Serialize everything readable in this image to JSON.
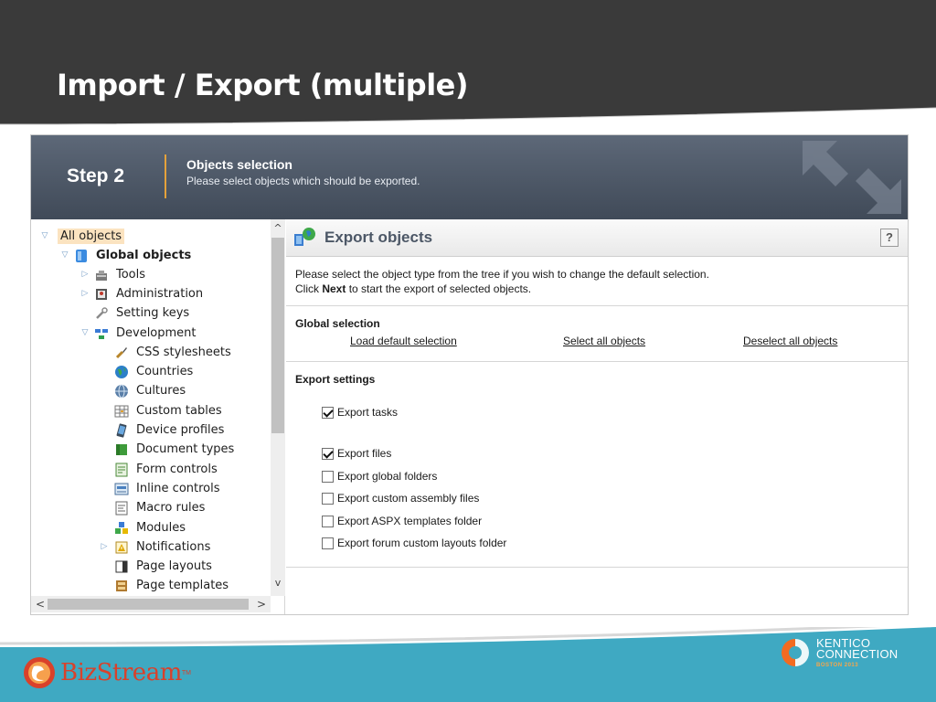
{
  "slide": {
    "title": "Import / Export (multiple)"
  },
  "wizard": {
    "step_label": "Step 2",
    "step_title": "Objects selection",
    "step_description": "Please select objects which should be exported."
  },
  "tree": {
    "items": [
      {
        "label": "All objects",
        "icon": "tree-root-icon",
        "expander": "expanded"
      },
      {
        "label": "Global objects",
        "icon": "global-objects-icon",
        "expander": "expanded"
      },
      {
        "label": "Tools",
        "icon": "tools-icon",
        "expander": "collapsed"
      },
      {
        "label": "Administration",
        "icon": "administration-icon",
        "expander": "collapsed"
      },
      {
        "label": "Setting keys",
        "icon": "wrench-icon",
        "expander": "none"
      },
      {
        "label": "Development",
        "icon": "development-icon",
        "expander": "expanded"
      },
      {
        "label": "CSS stylesheets",
        "icon": "css-icon",
        "expander": "none"
      },
      {
        "label": "Countries",
        "icon": "globe-icon",
        "expander": "none"
      },
      {
        "label": "Cultures",
        "icon": "cultures-icon",
        "expander": "none"
      },
      {
        "label": "Custom tables",
        "icon": "table-icon",
        "expander": "none"
      },
      {
        "label": "Device profiles",
        "icon": "device-icon",
        "expander": "none"
      },
      {
        "label": "Document types",
        "icon": "document-types-icon",
        "expander": "none"
      },
      {
        "label": "Form controls",
        "icon": "form-controls-icon",
        "expander": "none"
      },
      {
        "label": "Inline controls",
        "icon": "inline-controls-icon",
        "expander": "none"
      },
      {
        "label": "Macro rules",
        "icon": "macro-rules-icon",
        "expander": "none"
      },
      {
        "label": "Modules",
        "icon": "modules-icon",
        "expander": "none"
      },
      {
        "label": "Notifications",
        "icon": "notifications-icon",
        "expander": "collapsed"
      },
      {
        "label": "Page layouts",
        "icon": "page-layouts-icon",
        "expander": "none"
      },
      {
        "label": "Page templates",
        "icon": "page-templates-icon",
        "expander": "none"
      }
    ]
  },
  "content": {
    "title": "Export objects",
    "help_label": "?",
    "info_line1": "Please select the object type from the tree if you wish to change the default selection.",
    "info_line2_prefix": "Click ",
    "info_line2_bold": "Next",
    "info_line2_suffix": " to start the export of selected objects.",
    "global_selection": {
      "title": "Global selection",
      "load_default": "Load default selection",
      "select_all": "Select all objects",
      "deselect_all": "Deselect all objects"
    },
    "export_settings": {
      "title": "Export settings",
      "options": [
        {
          "label": "Export tasks",
          "checked": true
        },
        {
          "label": "Export files",
          "checked": true
        },
        {
          "label": "Export global folders",
          "checked": false
        },
        {
          "label": "Export custom assembly files",
          "checked": false
        },
        {
          "label": "Export ASPX templates folder",
          "checked": false
        },
        {
          "label": "Export forum custom layouts folder",
          "checked": false
        }
      ]
    }
  },
  "footer": {
    "bizstream_logo": "BizStream",
    "bizstream_tm": "TM",
    "kentico_line1": "KENTICO",
    "kentico_line2": "CONNECTION",
    "kentico_line3": "BOSTON 2013"
  },
  "colors": {
    "slide_header_bg": "#3a3a3a",
    "footer_teal": "#3fa9c2",
    "accent_orange": "#e5a23b",
    "wizard_header": "#4f5a69"
  }
}
